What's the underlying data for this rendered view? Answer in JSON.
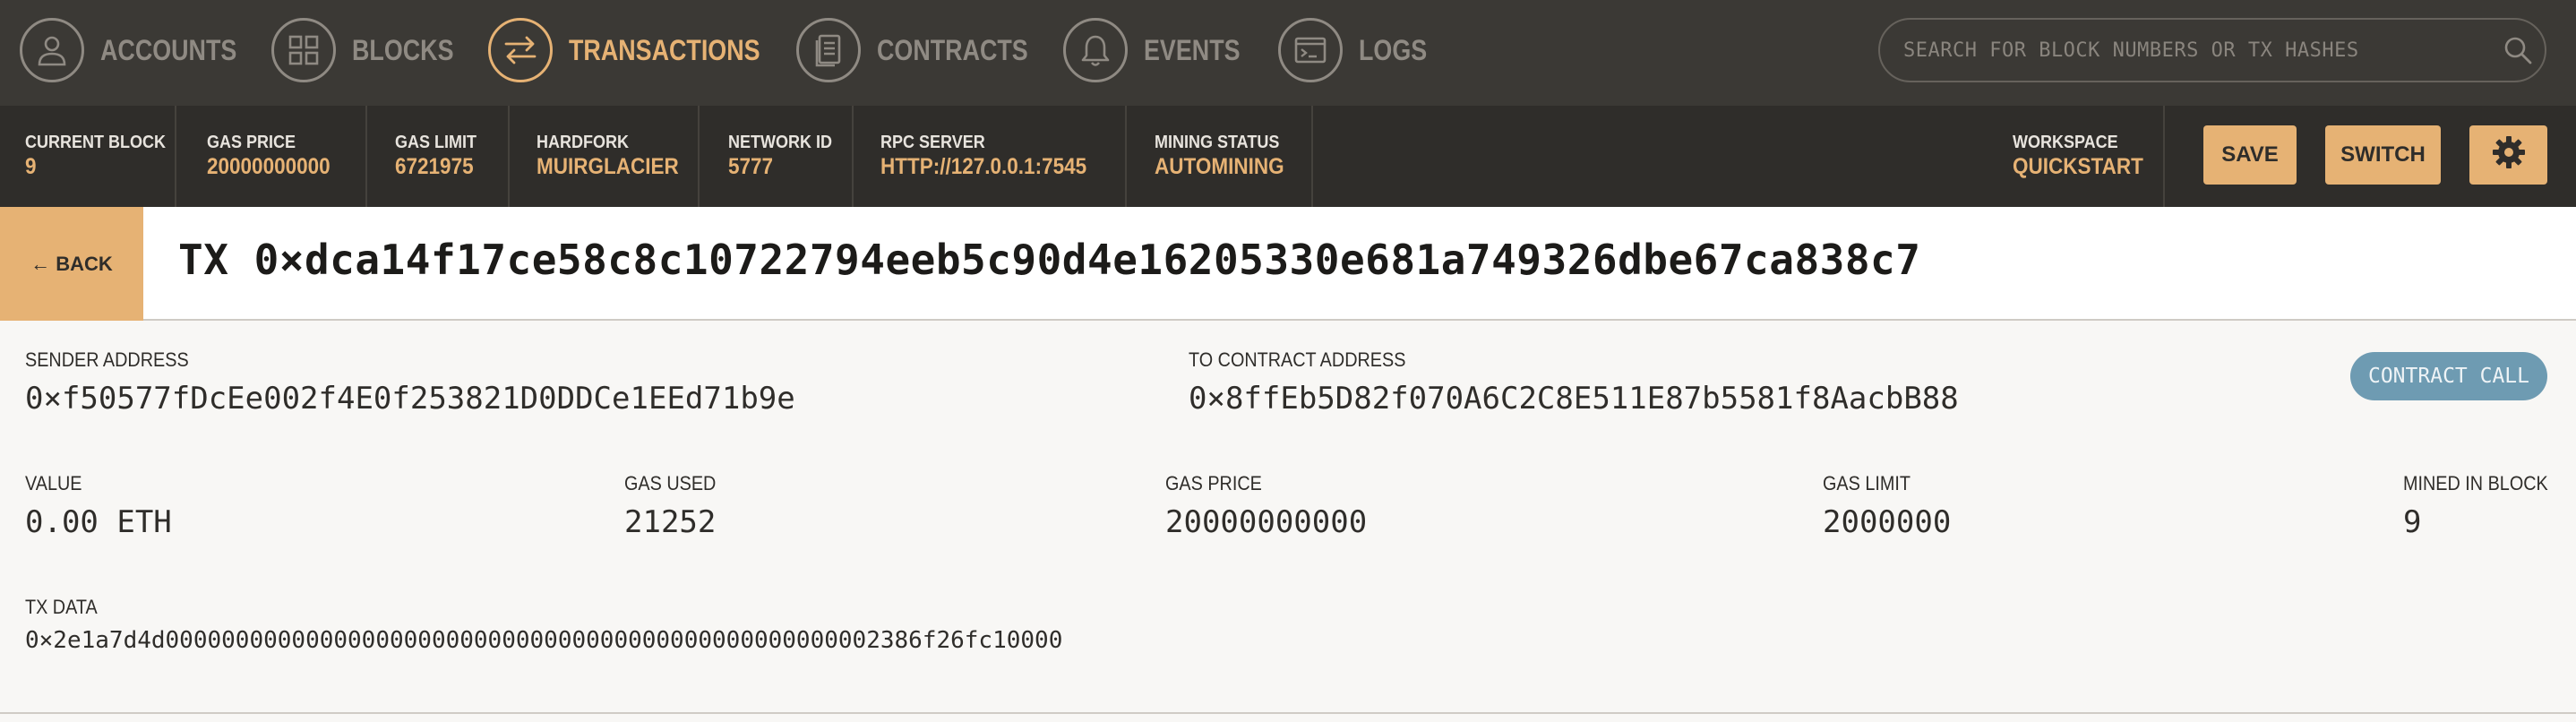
{
  "nav": {
    "items": [
      {
        "label": "ACCOUNTS",
        "icon": "person-icon",
        "active": false
      },
      {
        "label": "BLOCKS",
        "icon": "grid-icon",
        "active": false
      },
      {
        "label": "TRANSACTIONS",
        "icon": "arrows-exchange-icon",
        "active": true
      },
      {
        "label": "CONTRACTS",
        "icon": "document-icon",
        "active": false
      },
      {
        "label": "EVENTS",
        "icon": "bell-icon",
        "active": false
      },
      {
        "label": "LOGS",
        "icon": "terminal-icon",
        "active": false
      }
    ],
    "search_placeholder": "SEARCH FOR BLOCK NUMBERS OR TX HASHES"
  },
  "status": {
    "current_block": {
      "label": "CURRENT BLOCK",
      "value": "9"
    },
    "gas_price": {
      "label": "GAS PRICE",
      "value": "20000000000"
    },
    "gas_limit": {
      "label": "GAS LIMIT",
      "value": "6721975"
    },
    "hardfork": {
      "label": "HARDFORK",
      "value": "MUIRGLACIER"
    },
    "network_id": {
      "label": "NETWORK ID",
      "value": "5777"
    },
    "rpc_server": {
      "label": "RPC SERVER",
      "value": "HTTP://127.0.0.1:7545"
    },
    "mining_status": {
      "label": "MINING STATUS",
      "value": "AUTOMINING"
    },
    "workspace": {
      "label": "WORKSPACE",
      "value": "QUICKSTART"
    },
    "save_label": "SAVE",
    "switch_label": "SWITCH"
  },
  "tx": {
    "back_label": "← BACK",
    "title": "TX 0×dca14f17ce58c8c10722794eeb5c90d4e16205330e681a749326dbe67ca838c7",
    "sender": {
      "label": "SENDER ADDRESS",
      "value": "0×f50577fDcEe002f4E0f253821D0DDCe1EEd71b9e"
    },
    "to_contract": {
      "label": "TO CONTRACT ADDRESS",
      "value": "0×8ffEb5D82f070A6C2C8E511E87b5581f8AacbB88"
    },
    "badge": "CONTRACT CALL",
    "value": {
      "label": "VALUE",
      "value": "0.00 ETH"
    },
    "gas_used": {
      "label": "GAS USED",
      "value": "21252"
    },
    "gas_price": {
      "label": "GAS PRICE",
      "value": "20000000000"
    },
    "gas_limit": {
      "label": "GAS LIMIT",
      "value": "2000000"
    },
    "mined_in_block": {
      "label": "MINED IN BLOCK",
      "value": "9"
    },
    "tx_data": {
      "label": "TX DATA",
      "value": "0×2e1a7d4d000000000000000000000000000000000000000000000000002386f26fc10000"
    }
  },
  "colors": {
    "nav_bg": "#3b3935",
    "status_bg": "#2f2d2a",
    "accent": "#e6b274",
    "muted": "#8f8a83",
    "badge": "#6e9bb2"
  }
}
